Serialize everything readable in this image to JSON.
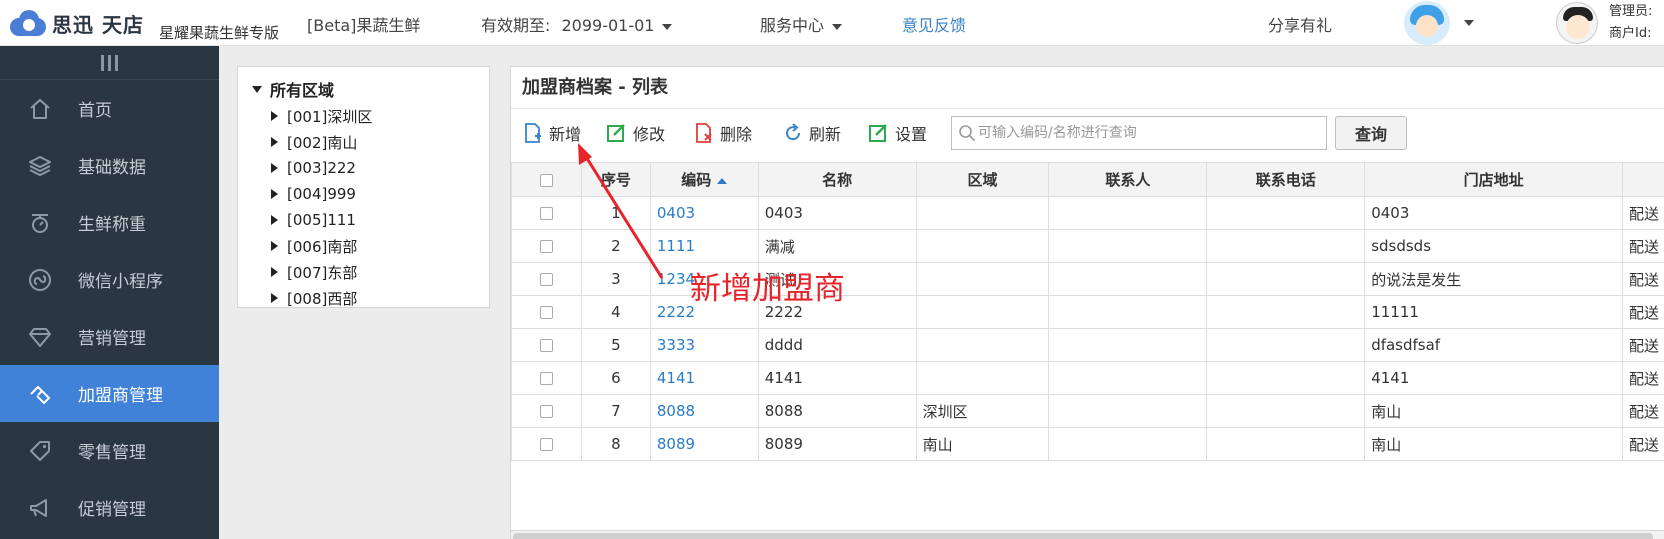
{
  "header": {
    "logo_text": "思迅",
    "logo_text2": "天店",
    "logo_sub": "星耀果蔬生鲜专版",
    "store_name": "[Beta]果蔬生鲜",
    "validity_label": "有效期至:",
    "validity_date": "2099-01-01",
    "service_center": "服务中心",
    "feedback": "意见反馈",
    "share_gift": "分享有礼",
    "admin_label": "管理员:",
    "merchant_label": "商户Id:"
  },
  "sidebar": {
    "items": [
      {
        "label": "首页",
        "icon": "home-icon"
      },
      {
        "label": "基础数据",
        "icon": "layers-icon"
      },
      {
        "label": "生鲜称重",
        "icon": "scale-icon"
      },
      {
        "label": "微信小程序",
        "icon": "miniprogram-icon"
      },
      {
        "label": "营销管理",
        "icon": "diamond-icon"
      },
      {
        "label": "加盟商管理",
        "icon": "handshake-icon",
        "active": true
      },
      {
        "label": "零售管理",
        "icon": "tag-icon"
      },
      {
        "label": "促销管理",
        "icon": "megaphone-icon"
      }
    ]
  },
  "tree": {
    "root": "所有区域",
    "items": [
      "[001]深圳区",
      "[002]南山",
      "[003]222",
      "[004]999",
      "[005]111",
      "[006]南部",
      "[007]东部",
      "[008]西部"
    ]
  },
  "main": {
    "title": "加盟商档案 - 列表",
    "toolbar": {
      "add": "新增",
      "edit": "修改",
      "delete": "删除",
      "refresh": "刷新",
      "settings": "设置",
      "search_placeholder": "可输入编码/名称进行查询",
      "query": "查询"
    },
    "columns": [
      "序号",
      "编码",
      "名称",
      "区域",
      "联系人",
      "联系电话",
      "门店地址",
      ""
    ],
    "rows": [
      {
        "no": "1",
        "code": "0403",
        "name": "0403",
        "region": "",
        "contact": "",
        "phone": "",
        "address": "0403",
        "extra": "配送"
      },
      {
        "no": "2",
        "code": "1111",
        "name": "满减",
        "region": "",
        "contact": "",
        "phone": "",
        "address": "sdsdsds",
        "extra": "配送"
      },
      {
        "no": "3",
        "code": "1234",
        "name": "测试",
        "region": "",
        "contact": "",
        "phone": "",
        "address": "的说法是发生",
        "extra": "配送"
      },
      {
        "no": "4",
        "code": "2222",
        "name": "2222",
        "region": "",
        "contact": "",
        "phone": "",
        "address": "11111",
        "extra": "配送"
      },
      {
        "no": "5",
        "code": "3333",
        "name": "dddd",
        "region": "",
        "contact": "",
        "phone": "",
        "address": "dfasdfsaf",
        "extra": "配送"
      },
      {
        "no": "6",
        "code": "4141",
        "name": "4141",
        "region": "",
        "contact": "",
        "phone": "",
        "address": "4141",
        "extra": "配送"
      },
      {
        "no": "7",
        "code": "8088",
        "name": "8088",
        "region": "深圳区",
        "contact": "",
        "phone": "",
        "address": "南山",
        "extra": "配送"
      },
      {
        "no": "8",
        "code": "8089",
        "name": "8089",
        "region": "南山",
        "contact": "",
        "phone": "",
        "address": "南山",
        "extra": "配送"
      }
    ]
  },
  "annotation": {
    "text": "新增加盟商",
    "color": "#e8242b"
  },
  "colors": {
    "sidebar_bg": "#2b3643",
    "active_nav": "#3f82d8",
    "link": "#2a7cc7"
  }
}
